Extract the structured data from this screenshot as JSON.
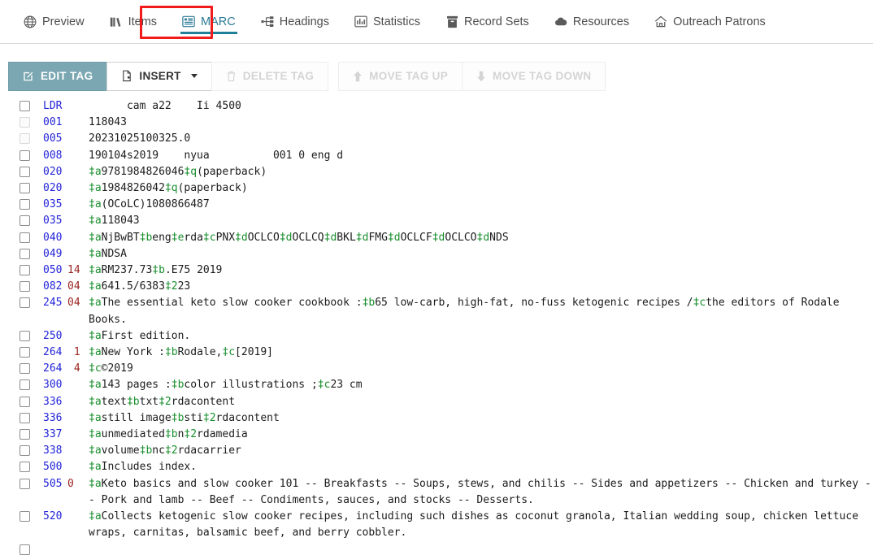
{
  "tabs": [
    {
      "label": "Preview",
      "icon": "globe-icon",
      "active": false
    },
    {
      "label": "Items",
      "icon": "books-icon",
      "active": false
    },
    {
      "label": "MARC",
      "icon": "marc-list-icon",
      "active": true
    },
    {
      "label": "Headings",
      "icon": "sitemap-icon",
      "active": false
    },
    {
      "label": "Statistics",
      "icon": "bar-chart-icon",
      "active": false
    },
    {
      "label": "Record Sets",
      "icon": "archive-icon",
      "active": false
    },
    {
      "label": "Resources",
      "icon": "cloud-icon",
      "active": false
    },
    {
      "label": "Outreach Patrons",
      "icon": "home-icon",
      "active": false
    }
  ],
  "annotation": {
    "target_tab": "MARC",
    "color": "#f21b1b"
  },
  "toolbar": {
    "edit_tag": "EDIT TAG",
    "insert": "INSERT",
    "delete_tag": "DELETE TAG",
    "move_tag_up": "MOVE TAG UP",
    "move_tag_down": "MOVE TAG DOWN"
  },
  "colors": {
    "accent": "#1f7f99",
    "primary_button": "#7ba7b2",
    "tag": "#2324d8",
    "indicator": "#9b2622",
    "subfield": "#1a8f2e",
    "annotation": "#f21b1b"
  },
  "marc": {
    "rows": [
      {
        "tag": "LDR",
        "ind": "",
        "checkbox": "enabled",
        "parts": [
          {
            "t": "text",
            "v": "      cam a22    Ii 4500"
          }
        ]
      },
      {
        "tag": "001",
        "ind": "",
        "checkbox": "disabled",
        "parts": [
          {
            "t": "text",
            "v": "118043"
          }
        ]
      },
      {
        "tag": "005",
        "ind": "",
        "checkbox": "disabled",
        "parts": [
          {
            "t": "text",
            "v": "20231025100325.0"
          }
        ]
      },
      {
        "tag": "008",
        "ind": "",
        "checkbox": "enabled",
        "parts": [
          {
            "t": "text",
            "v": "190104s2019    nyua          001 0 eng d"
          }
        ]
      },
      {
        "tag": "020",
        "ind": "",
        "checkbox": "enabled",
        "parts": [
          {
            "t": "sf",
            "v": "‡a"
          },
          {
            "t": "text",
            "v": "9781984826046"
          },
          {
            "t": "sf",
            "v": "‡q"
          },
          {
            "t": "text",
            "v": "(paperback)"
          }
        ]
      },
      {
        "tag": "020",
        "ind": "",
        "checkbox": "enabled",
        "parts": [
          {
            "t": "sf",
            "v": "‡a"
          },
          {
            "t": "text",
            "v": "1984826042"
          },
          {
            "t": "sf",
            "v": "‡q"
          },
          {
            "t": "text",
            "v": "(paperback)"
          }
        ]
      },
      {
        "tag": "035",
        "ind": "",
        "checkbox": "enabled",
        "parts": [
          {
            "t": "sf",
            "v": "‡a"
          },
          {
            "t": "text",
            "v": "(OCoLC)1080866487"
          }
        ]
      },
      {
        "tag": "035",
        "ind": "",
        "checkbox": "enabled",
        "parts": [
          {
            "t": "sf",
            "v": "‡a"
          },
          {
            "t": "text",
            "v": "118043"
          }
        ]
      },
      {
        "tag": "040",
        "ind": "",
        "checkbox": "enabled",
        "parts": [
          {
            "t": "sf",
            "v": "‡a"
          },
          {
            "t": "text",
            "v": "NjBwBT"
          },
          {
            "t": "sf",
            "v": "‡b"
          },
          {
            "t": "text",
            "v": "eng"
          },
          {
            "t": "sf",
            "v": "‡e"
          },
          {
            "t": "text",
            "v": "rda"
          },
          {
            "t": "sf",
            "v": "‡c"
          },
          {
            "t": "text",
            "v": "PNX"
          },
          {
            "t": "sf",
            "v": "‡d"
          },
          {
            "t": "text",
            "v": "OCLCO"
          },
          {
            "t": "sf",
            "v": "‡d"
          },
          {
            "t": "text",
            "v": "OCLCQ"
          },
          {
            "t": "sf",
            "v": "‡d"
          },
          {
            "t": "text",
            "v": "BKL"
          },
          {
            "t": "sf",
            "v": "‡d"
          },
          {
            "t": "text",
            "v": "FMG"
          },
          {
            "t": "sf",
            "v": "‡d"
          },
          {
            "t": "text",
            "v": "OCLCF"
          },
          {
            "t": "sf",
            "v": "‡d"
          },
          {
            "t": "text",
            "v": "OCLCO"
          },
          {
            "t": "sf",
            "v": "‡d"
          },
          {
            "t": "text",
            "v": "NDS"
          }
        ]
      },
      {
        "tag": "049",
        "ind": "",
        "checkbox": "enabled",
        "parts": [
          {
            "t": "sf",
            "v": "‡a"
          },
          {
            "t": "text",
            "v": "NDSA"
          }
        ]
      },
      {
        "tag": "050",
        "ind": "14",
        "checkbox": "enabled",
        "parts": [
          {
            "t": "sf",
            "v": "‡a"
          },
          {
            "t": "text",
            "v": "RM237.73"
          },
          {
            "t": "sf",
            "v": "‡b"
          },
          {
            "t": "text",
            "v": ".E75 2019"
          }
        ]
      },
      {
        "tag": "082",
        "ind": "04",
        "checkbox": "enabled",
        "parts": [
          {
            "t": "sf",
            "v": "‡a"
          },
          {
            "t": "text",
            "v": "641.5/6383"
          },
          {
            "t": "sf",
            "v": "‡2"
          },
          {
            "t": "text",
            "v": "23"
          }
        ]
      },
      {
        "tag": "245",
        "ind": "04",
        "checkbox": "enabled",
        "parts": [
          {
            "t": "sf",
            "v": "‡a"
          },
          {
            "t": "text",
            "v": "The essential keto slow cooker cookbook :"
          },
          {
            "t": "sf",
            "v": "‡b"
          },
          {
            "t": "text",
            "v": "65 low-carb, high-fat, no-fuss ketogenic recipes /"
          },
          {
            "t": "sf",
            "v": "‡c"
          },
          {
            "t": "text",
            "v": "the editors of Rodale Books."
          }
        ]
      },
      {
        "tag": "250",
        "ind": "",
        "checkbox": "enabled",
        "parts": [
          {
            "t": "sf",
            "v": "‡a"
          },
          {
            "t": "text",
            "v": "First edition."
          }
        ]
      },
      {
        "tag": "264",
        "ind": " 1",
        "checkbox": "enabled",
        "parts": [
          {
            "t": "sf",
            "v": "‡a"
          },
          {
            "t": "text",
            "v": "New York :"
          },
          {
            "t": "sf",
            "v": "‡b"
          },
          {
            "t": "text",
            "v": "Rodale,"
          },
          {
            "t": "sf",
            "v": "‡c"
          },
          {
            "t": "text",
            "v": "[2019]"
          }
        ]
      },
      {
        "tag": "264",
        "ind": " 4",
        "checkbox": "enabled",
        "parts": [
          {
            "t": "sf",
            "v": "‡c"
          },
          {
            "t": "text",
            "v": "©2019"
          }
        ]
      },
      {
        "tag": "300",
        "ind": "",
        "checkbox": "enabled",
        "parts": [
          {
            "t": "sf",
            "v": "‡a"
          },
          {
            "t": "text",
            "v": "143 pages :"
          },
          {
            "t": "sf",
            "v": "‡b"
          },
          {
            "t": "text",
            "v": "color illustrations ;"
          },
          {
            "t": "sf",
            "v": "‡c"
          },
          {
            "t": "text",
            "v": "23 cm"
          }
        ]
      },
      {
        "tag": "336",
        "ind": "",
        "checkbox": "enabled",
        "parts": [
          {
            "t": "sf",
            "v": "‡a"
          },
          {
            "t": "text",
            "v": "text"
          },
          {
            "t": "sf",
            "v": "‡b"
          },
          {
            "t": "text",
            "v": "txt"
          },
          {
            "t": "sf",
            "v": "‡2"
          },
          {
            "t": "text",
            "v": "rdacontent"
          }
        ]
      },
      {
        "tag": "336",
        "ind": "",
        "checkbox": "enabled",
        "parts": [
          {
            "t": "sf",
            "v": "‡a"
          },
          {
            "t": "text",
            "v": "still image"
          },
          {
            "t": "sf",
            "v": "‡b"
          },
          {
            "t": "text",
            "v": "sti"
          },
          {
            "t": "sf",
            "v": "‡2"
          },
          {
            "t": "text",
            "v": "rdacontent"
          }
        ]
      },
      {
        "tag": "337",
        "ind": "",
        "checkbox": "enabled",
        "parts": [
          {
            "t": "sf",
            "v": "‡a"
          },
          {
            "t": "text",
            "v": "unmediated"
          },
          {
            "t": "sf",
            "v": "‡b"
          },
          {
            "t": "text",
            "v": "n"
          },
          {
            "t": "sf",
            "v": "‡2"
          },
          {
            "t": "text",
            "v": "rdamedia"
          }
        ]
      },
      {
        "tag": "338",
        "ind": "",
        "checkbox": "enabled",
        "parts": [
          {
            "t": "sf",
            "v": "‡a"
          },
          {
            "t": "text",
            "v": "volume"
          },
          {
            "t": "sf",
            "v": "‡b"
          },
          {
            "t": "text",
            "v": "nc"
          },
          {
            "t": "sf",
            "v": "‡2"
          },
          {
            "t": "text",
            "v": "rdacarrier"
          }
        ]
      },
      {
        "tag": "500",
        "ind": "",
        "checkbox": "enabled",
        "parts": [
          {
            "t": "sf",
            "v": "‡a"
          },
          {
            "t": "text",
            "v": "Includes index."
          }
        ]
      },
      {
        "tag": "505",
        "ind": "0",
        "checkbox": "enabled",
        "parts": [
          {
            "t": "sf",
            "v": "‡a"
          },
          {
            "t": "text",
            "v": "Keto basics and slow cooker 101 -- Breakfasts -- Soups, stews, and chilis -- Sides and appetizers -- Chicken and turkey -- Pork and lamb -- Beef -- Condiments, sauces, and stocks -- Desserts."
          }
        ]
      },
      {
        "tag": "520",
        "ind": "",
        "checkbox": "enabled",
        "parts": [
          {
            "t": "sf",
            "v": "‡a"
          },
          {
            "t": "text",
            "v": "Collects ketogenic slow cooker recipes, including such dishes as coconut granola, Italian wedding soup, chicken lettuce wraps, carnitas, balsamic beef, and berry cobbler."
          }
        ]
      },
      {
        "tag": "",
        "ind": "",
        "checkbox": "enabled",
        "parts": []
      }
    ]
  }
}
